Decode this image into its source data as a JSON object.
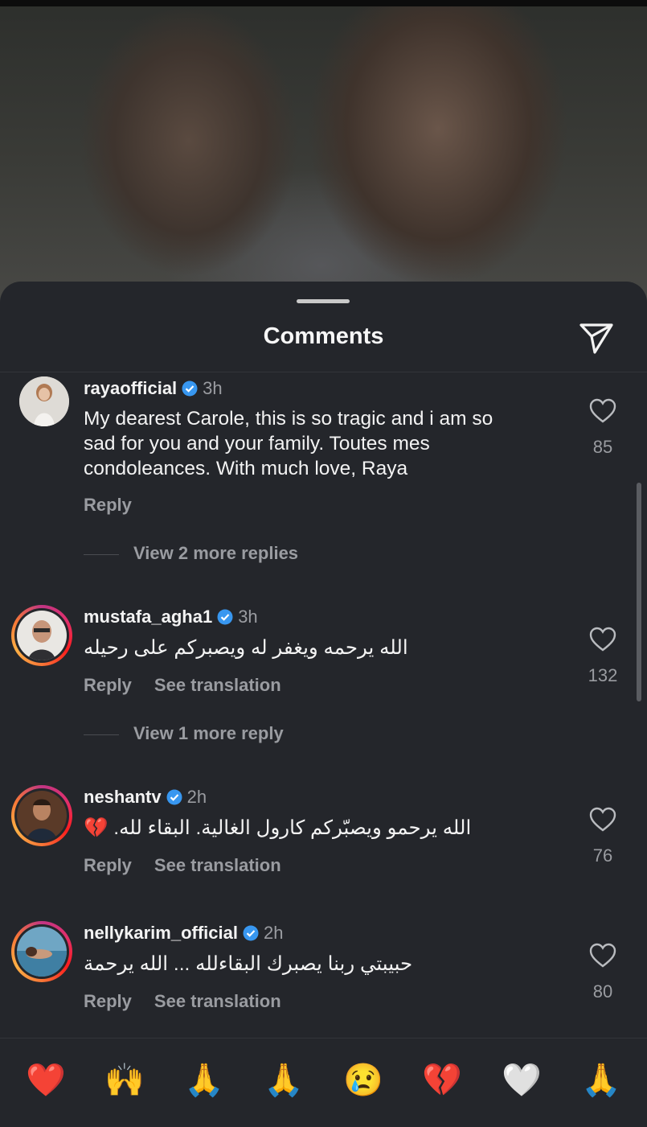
{
  "header": {
    "title": "Comments",
    "share_icon": "send-icon"
  },
  "comments": [
    {
      "username": "rayaofficial",
      "verified": true,
      "time": "3h",
      "text_lines": [
        "My dearest Carole, this is so tragic and  i am so",
        "sad for you and your family. Toutes mes",
        "condoleances. With much love, Raya"
      ],
      "reply": "Reply",
      "likes": "85",
      "more_replies": "View 2 more replies"
    },
    {
      "username": "mustafa_agha1",
      "verified": true,
      "time": "3h",
      "text": "الله يرحمه ويغفر له ويصبركم على  رحيله",
      "reply": "Reply",
      "see_translation": "See translation",
      "likes": "132",
      "more_replies": "View 1 more reply"
    },
    {
      "username": "neshantv",
      "verified": true,
      "time": "2h",
      "text": "الله يرحمو ويصبّركم كارول الغالية. البقاء لله. 💔",
      "reply": "Reply",
      "see_translation": "See translation",
      "likes": "76"
    },
    {
      "username": "nellykarim_official",
      "verified": true,
      "time": "2h",
      "text": "حبيبتي ربنا يصبرك البقاءلله ... الله يرحمة",
      "reply": "Reply",
      "see_translation": "See translation",
      "likes": "80"
    }
  ],
  "emoji_bar": [
    "❤️",
    "🙌",
    "🙏",
    "🙏",
    "😢",
    "💔",
    "🤍",
    "🙏"
  ],
  "colors": {
    "background": "#24262b",
    "verified": "#3897f0",
    "secondary_text": "#9a9ca1"
  }
}
